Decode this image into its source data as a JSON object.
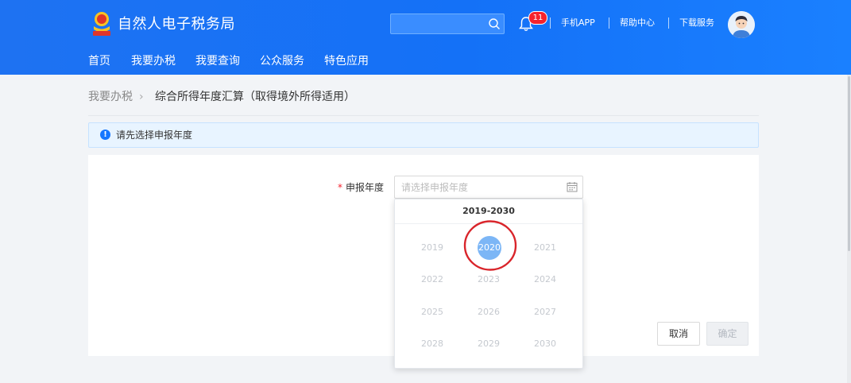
{
  "header": {
    "site_title": "自然人电子税务局",
    "search": {
      "placeholder": ""
    },
    "notification_count": "11",
    "links": [
      "手机APP",
      "帮助中心",
      "下载服务"
    ]
  },
  "nav": {
    "items": [
      "首页",
      "我要办税",
      "我要查询",
      "公众服务",
      "特色应用"
    ]
  },
  "breadcrumb": {
    "root": "我要办税",
    "separator": "›",
    "current": "综合所得年度汇算（取得境外所得适用）"
  },
  "notice": {
    "icon": "!",
    "text": "请先选择申报年度"
  },
  "form": {
    "required_mark": "*",
    "year_label": "申报年度",
    "year_placeholder": "请选择申报年度"
  },
  "picker": {
    "range_label": "2019-2030",
    "years": [
      "2019",
      "2020",
      "2021",
      "2022",
      "2023",
      "2024",
      "2025",
      "2026",
      "2027",
      "2028",
      "2029",
      "2030"
    ],
    "selected": "2020"
  },
  "actions": {
    "cancel": "取消",
    "confirm": "确定"
  },
  "colors": {
    "header_blue": "#1471f7",
    "selected_year": "#7cb6f6",
    "annotation_red": "#d9252b",
    "badge_red": "#f5222d"
  }
}
